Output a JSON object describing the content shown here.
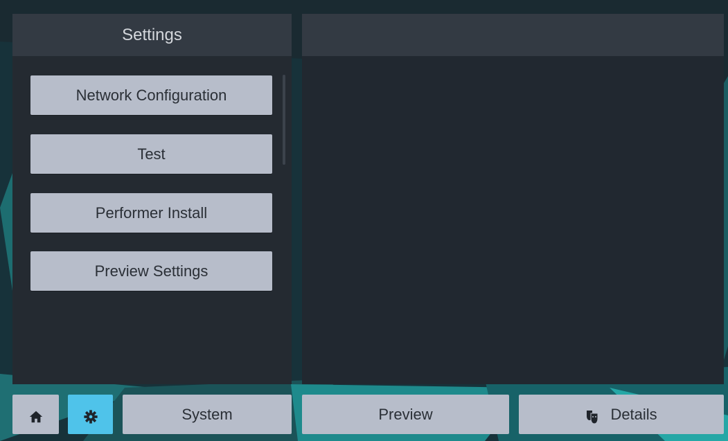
{
  "settings_panel": {
    "title": "Settings",
    "menu_items": [
      {
        "label": "Network Configuration"
      },
      {
        "label": "Test"
      },
      {
        "label": "Performer Install"
      },
      {
        "label": "Preview Settings"
      }
    ]
  },
  "bottom_bar": {
    "home_icon": "home-icon",
    "settings_icon": "gear-icon",
    "system_label": "System",
    "preview_label": "Preview",
    "details_icon": "masks-icon",
    "details_label": "Details"
  },
  "colors": {
    "button_bg": "#b7bdca",
    "active_button_bg": "#4fc3ea",
    "panel_bg": "#242a31",
    "header_bg": "#333a43",
    "accent_teal": "#1e8c8e"
  }
}
